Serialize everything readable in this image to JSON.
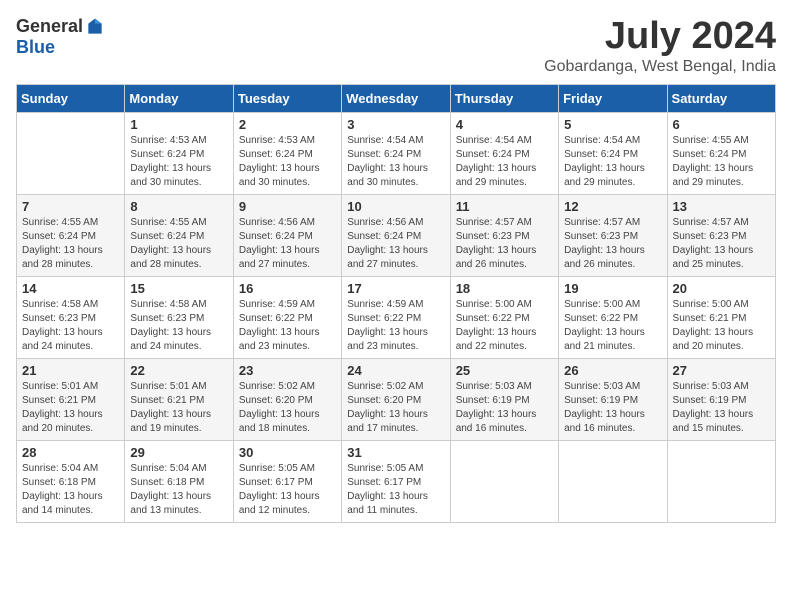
{
  "header": {
    "logo_general": "General",
    "logo_blue": "Blue",
    "month_year": "July 2024",
    "location": "Gobardanga, West Bengal, India"
  },
  "weekdays": [
    "Sunday",
    "Monday",
    "Tuesday",
    "Wednesday",
    "Thursday",
    "Friday",
    "Saturday"
  ],
  "weeks": [
    [
      {
        "day": "",
        "info": ""
      },
      {
        "day": "1",
        "info": "Sunrise: 4:53 AM\nSunset: 6:24 PM\nDaylight: 13 hours\nand 30 minutes."
      },
      {
        "day": "2",
        "info": "Sunrise: 4:53 AM\nSunset: 6:24 PM\nDaylight: 13 hours\nand 30 minutes."
      },
      {
        "day": "3",
        "info": "Sunrise: 4:54 AM\nSunset: 6:24 PM\nDaylight: 13 hours\nand 30 minutes."
      },
      {
        "day": "4",
        "info": "Sunrise: 4:54 AM\nSunset: 6:24 PM\nDaylight: 13 hours\nand 29 minutes."
      },
      {
        "day": "5",
        "info": "Sunrise: 4:54 AM\nSunset: 6:24 PM\nDaylight: 13 hours\nand 29 minutes."
      },
      {
        "day": "6",
        "info": "Sunrise: 4:55 AM\nSunset: 6:24 PM\nDaylight: 13 hours\nand 29 minutes."
      }
    ],
    [
      {
        "day": "7",
        "info": "Sunrise: 4:55 AM\nSunset: 6:24 PM\nDaylight: 13 hours\nand 28 minutes."
      },
      {
        "day": "8",
        "info": "Sunrise: 4:55 AM\nSunset: 6:24 PM\nDaylight: 13 hours\nand 28 minutes."
      },
      {
        "day": "9",
        "info": "Sunrise: 4:56 AM\nSunset: 6:24 PM\nDaylight: 13 hours\nand 27 minutes."
      },
      {
        "day": "10",
        "info": "Sunrise: 4:56 AM\nSunset: 6:24 PM\nDaylight: 13 hours\nand 27 minutes."
      },
      {
        "day": "11",
        "info": "Sunrise: 4:57 AM\nSunset: 6:23 PM\nDaylight: 13 hours\nand 26 minutes."
      },
      {
        "day": "12",
        "info": "Sunrise: 4:57 AM\nSunset: 6:23 PM\nDaylight: 13 hours\nand 26 minutes."
      },
      {
        "day": "13",
        "info": "Sunrise: 4:57 AM\nSunset: 6:23 PM\nDaylight: 13 hours\nand 25 minutes."
      }
    ],
    [
      {
        "day": "14",
        "info": "Sunrise: 4:58 AM\nSunset: 6:23 PM\nDaylight: 13 hours\nand 24 minutes."
      },
      {
        "day": "15",
        "info": "Sunrise: 4:58 AM\nSunset: 6:23 PM\nDaylight: 13 hours\nand 24 minutes."
      },
      {
        "day": "16",
        "info": "Sunrise: 4:59 AM\nSunset: 6:22 PM\nDaylight: 13 hours\nand 23 minutes."
      },
      {
        "day": "17",
        "info": "Sunrise: 4:59 AM\nSunset: 6:22 PM\nDaylight: 13 hours\nand 23 minutes."
      },
      {
        "day": "18",
        "info": "Sunrise: 5:00 AM\nSunset: 6:22 PM\nDaylight: 13 hours\nand 22 minutes."
      },
      {
        "day": "19",
        "info": "Sunrise: 5:00 AM\nSunset: 6:22 PM\nDaylight: 13 hours\nand 21 minutes."
      },
      {
        "day": "20",
        "info": "Sunrise: 5:00 AM\nSunset: 6:21 PM\nDaylight: 13 hours\nand 20 minutes."
      }
    ],
    [
      {
        "day": "21",
        "info": "Sunrise: 5:01 AM\nSunset: 6:21 PM\nDaylight: 13 hours\nand 20 minutes."
      },
      {
        "day": "22",
        "info": "Sunrise: 5:01 AM\nSunset: 6:21 PM\nDaylight: 13 hours\nand 19 minutes."
      },
      {
        "day": "23",
        "info": "Sunrise: 5:02 AM\nSunset: 6:20 PM\nDaylight: 13 hours\nand 18 minutes."
      },
      {
        "day": "24",
        "info": "Sunrise: 5:02 AM\nSunset: 6:20 PM\nDaylight: 13 hours\nand 17 minutes."
      },
      {
        "day": "25",
        "info": "Sunrise: 5:03 AM\nSunset: 6:19 PM\nDaylight: 13 hours\nand 16 minutes."
      },
      {
        "day": "26",
        "info": "Sunrise: 5:03 AM\nSunset: 6:19 PM\nDaylight: 13 hours\nand 16 minutes."
      },
      {
        "day": "27",
        "info": "Sunrise: 5:03 AM\nSunset: 6:19 PM\nDaylight: 13 hours\nand 15 minutes."
      }
    ],
    [
      {
        "day": "28",
        "info": "Sunrise: 5:04 AM\nSunset: 6:18 PM\nDaylight: 13 hours\nand 14 minutes."
      },
      {
        "day": "29",
        "info": "Sunrise: 5:04 AM\nSunset: 6:18 PM\nDaylight: 13 hours\nand 13 minutes."
      },
      {
        "day": "30",
        "info": "Sunrise: 5:05 AM\nSunset: 6:17 PM\nDaylight: 13 hours\nand 12 minutes."
      },
      {
        "day": "31",
        "info": "Sunrise: 5:05 AM\nSunset: 6:17 PM\nDaylight: 13 hours\nand 11 minutes."
      },
      {
        "day": "",
        "info": ""
      },
      {
        "day": "",
        "info": ""
      },
      {
        "day": "",
        "info": ""
      }
    ]
  ]
}
